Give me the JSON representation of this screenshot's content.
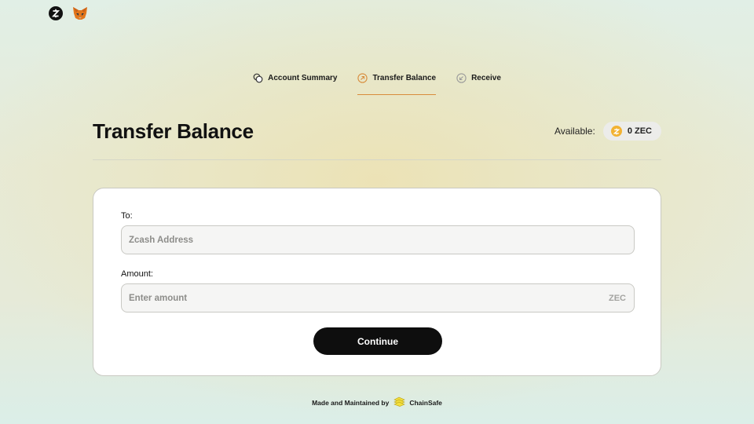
{
  "top_logos": {
    "zcash_icon": "zcash-logo-icon",
    "fox_icon": "metamask-fox-icon"
  },
  "tabs": [
    {
      "label": "Account Summary",
      "icon": "coins-icon",
      "active": false
    },
    {
      "label": "Transfer Balance",
      "icon": "arrow-up-right-icon",
      "active": true
    },
    {
      "label": "Receive",
      "icon": "arrow-down-left-icon",
      "active": false
    }
  ],
  "header": {
    "title": "Transfer Balance",
    "available_label": "Available:",
    "balance": "0 ZEC"
  },
  "form": {
    "to_label": "To:",
    "to_placeholder": "Zcash Address",
    "amount_label": "Amount:",
    "amount_placeholder": "Enter amount",
    "amount_unit": "ZEC",
    "continue_label": "Continue"
  },
  "footer": {
    "made_by": "Made and Maintained by",
    "brand": "ChainSafe"
  },
  "colors": {
    "accent": "#d88c3c",
    "coin": "#f2b233",
    "button": "#0e0e0e"
  }
}
